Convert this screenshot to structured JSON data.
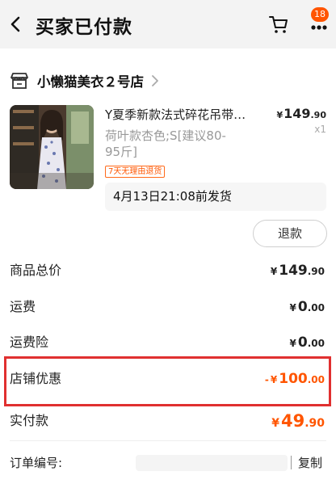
{
  "header": {
    "title": "买家已付款",
    "cart_badge": "18"
  },
  "shop": {
    "name": "小懒猫美衣２号店"
  },
  "product": {
    "title": "Y夏季新款法式碎花吊带…",
    "price_symbol": "¥",
    "price_int": "149",
    "price_dec": ".90",
    "spec": "荷叶款杏色;S[建议80-95斤]",
    "quantity": "x1",
    "tag": "7天无理由退货"
  },
  "shipping_note": "4月13日21:08前发货",
  "refund_button": "退款",
  "summary": {
    "goods_total": {
      "label": "商品总价",
      "symbol": "¥",
      "int": "149",
      "dec": ".90"
    },
    "shipping": {
      "label": "运费",
      "symbol": "¥",
      "int": "0",
      "dec": ".00"
    },
    "shipping_insurance": {
      "label": "运费险",
      "symbol": "¥",
      "int": "0",
      "dec": ".00"
    },
    "shop_discount": {
      "label": "店铺优惠",
      "sign": "-",
      "symbol": "¥",
      "int": "100",
      "dec": ".00"
    },
    "actual_paid": {
      "label": "实付款",
      "symbol": "¥",
      "int": "49",
      "dec": ".90"
    }
  },
  "order": {
    "label": "订单编号:",
    "copy_label": "复制"
  },
  "colors": {
    "accent": "#ff5500",
    "highlight_box": "#e03030",
    "header_bg": "#f3f3f3"
  },
  "icons": [
    "back-arrow-icon",
    "cart-icon",
    "more-icon",
    "shop-icon",
    "chevron-right-icon"
  ]
}
